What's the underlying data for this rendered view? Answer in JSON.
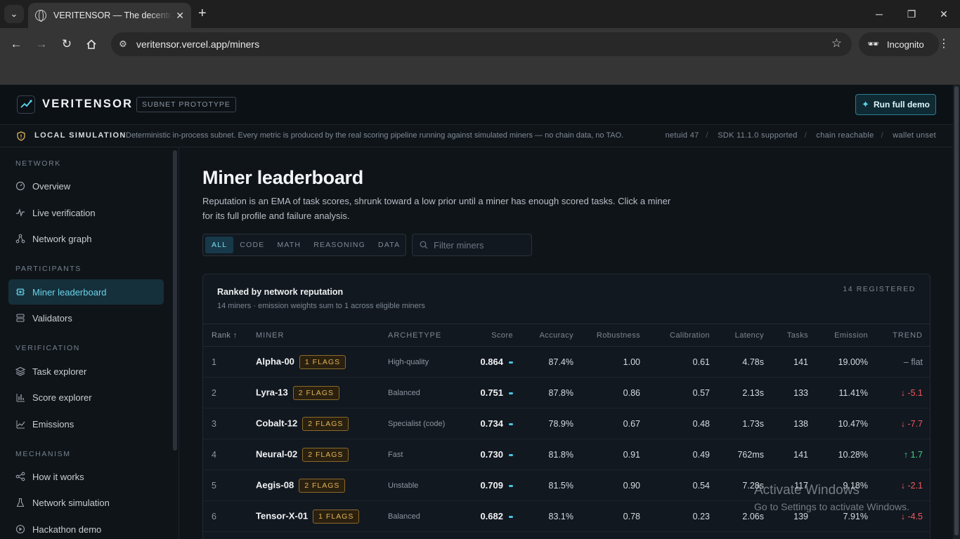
{
  "browser": {
    "tab_title": "VERITENSOR — The decentralized verification network",
    "url": "veritensor.vercel.app/miners",
    "incognito_label": "Incognito"
  },
  "header": {
    "brand": "VERITENSOR",
    "badge": "SUBNET PROTOTYPE",
    "run_demo": "Run full demo"
  },
  "sim_bar": {
    "label": "LOCAL SIMULATION",
    "description": "Deterministic in-process subnet. Every metric is produced by the real scoring pipeline running against simulated miners — no chain data, no TAO.",
    "meta": [
      "netuid 47",
      "SDK 11.1.0 supported",
      "chain reachable",
      "wallet unset"
    ]
  },
  "sidebar": {
    "sections": [
      {
        "title": "NETWORK",
        "items": [
          {
            "label": "Overview",
            "icon": "gauge-icon"
          },
          {
            "label": "Live verification",
            "icon": "pulse-icon"
          },
          {
            "label": "Network graph",
            "icon": "graph-icon"
          }
        ]
      },
      {
        "title": "PARTICIPANTS",
        "items": [
          {
            "label": "Miner leaderboard",
            "icon": "chip-icon",
            "active": true
          },
          {
            "label": "Validators",
            "icon": "server-icon"
          }
        ]
      },
      {
        "title": "VERIFICATION",
        "items": [
          {
            "label": "Task explorer",
            "icon": "layers-icon"
          },
          {
            "label": "Score explorer",
            "icon": "bar-chart-icon"
          },
          {
            "label": "Emissions",
            "icon": "line-chart-icon"
          }
        ]
      },
      {
        "title": "MECHANISM",
        "items": [
          {
            "label": "How it works",
            "icon": "nodes-icon"
          },
          {
            "label": "Network simulation",
            "icon": "flask-icon"
          },
          {
            "label": "Hackathon demo",
            "icon": "play-icon"
          }
        ]
      }
    ]
  },
  "main": {
    "title": "Miner leaderboard",
    "lead": "Reputation is an EMA of task scores, shrunk toward a low prior until a miner has enough scored tasks. Click a miner for its full profile and failure analysis.",
    "filters": [
      "ALL",
      "CODE",
      "MATH",
      "REASONING",
      "DATA"
    ],
    "active_filter": "ALL",
    "search_placeholder": "Filter miners",
    "card": {
      "title": "Ranked by network reputation",
      "subtitle": "14 miners · emission weights sum to 1 across eligible miners",
      "count": "14 REGISTERED"
    },
    "columns": [
      "Rank ↑",
      "MINER",
      "ARCHETYPE",
      "Score",
      "Accuracy",
      "Robustness",
      "Calibration",
      "Latency",
      "Tasks",
      "Emission",
      "TREND"
    ],
    "rows": [
      {
        "rank": "1",
        "miner": "Alpha-00",
        "flags": "1 FLAGS",
        "archetype": "High-quality",
        "score": "0.864",
        "accuracy": "87.4%",
        "robustness": "1.00",
        "calibration": "0.61",
        "latency": "4.78s",
        "tasks": "141",
        "emission": "19.00%",
        "trend": "– flat",
        "trend_dir": "flat"
      },
      {
        "rank": "2",
        "miner": "Lyra-13",
        "flags": "2 FLAGS",
        "archetype": "Balanced",
        "score": "0.751",
        "accuracy": "87.8%",
        "robustness": "0.86",
        "calibration": "0.57",
        "latency": "2.13s",
        "tasks": "133",
        "emission": "11.41%",
        "trend": "↓ -5.1",
        "trend_dir": "down"
      },
      {
        "rank": "3",
        "miner": "Cobalt-12",
        "flags": "2 FLAGS",
        "archetype": "Specialist (code)",
        "score": "0.734",
        "accuracy": "78.9%",
        "robustness": "0.67",
        "calibration": "0.48",
        "latency": "1.73s",
        "tasks": "138",
        "emission": "10.47%",
        "trend": "↓ -7.7",
        "trend_dir": "down"
      },
      {
        "rank": "4",
        "miner": "Neural-02",
        "flags": "2 FLAGS",
        "archetype": "Fast",
        "score": "0.730",
        "accuracy": "81.8%",
        "robustness": "0.91",
        "calibration": "0.49",
        "latency": "762ms",
        "tasks": "141",
        "emission": "10.28%",
        "trend": "↑ 1.7",
        "trend_dir": "up"
      },
      {
        "rank": "5",
        "miner": "Aegis-08",
        "flags": "2 FLAGS",
        "archetype": "Unstable",
        "score": "0.709",
        "accuracy": "81.5%",
        "robustness": "0.90",
        "calibration": "0.54",
        "latency": "7.28s",
        "tasks": "117",
        "emission": "9.18%",
        "trend": "↓ -2.1",
        "trend_dir": "down"
      },
      {
        "rank": "6",
        "miner": "Tensor-X-01",
        "flags": "1 FLAGS",
        "archetype": "Balanced",
        "score": "0.682",
        "accuracy": "83.1%",
        "robustness": "0.78",
        "calibration": "0.23",
        "latency": "2.06s",
        "tasks": "139",
        "emission": "7.91%",
        "trend": "↓ -4.5",
        "trend_dir": "down"
      }
    ]
  },
  "watermark": {
    "line1": "Activate Windows",
    "line2": "Go to Settings to activate Windows."
  },
  "colors": {
    "accent": "#49c6e5",
    "flag": "#e0b356",
    "up": "#3fd08a",
    "down": "#f0585b",
    "bg": "#0f1419"
  }
}
